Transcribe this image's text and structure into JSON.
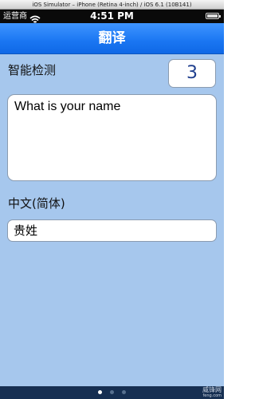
{
  "window": {
    "title": "iOS Simulator – iPhone (Retina 4-inch) / iOS 6.1 (10B141)"
  },
  "status_bar": {
    "carrier": "运营商",
    "time": "4:51 PM",
    "wifi_icon": "wifi-icon",
    "battery_icon": "battery-icon"
  },
  "nav": {
    "title": "翻译"
  },
  "detect": {
    "label": "智能检测",
    "count": "3"
  },
  "source": {
    "text": "What is your name"
  },
  "target": {
    "language": "中文(简体)",
    "result": "贵姓"
  },
  "page_control": {
    "pages": 3,
    "current": 1
  },
  "watermark": {
    "main": "威锋网",
    "sub": "feng.com"
  },
  "colors": {
    "nav_bar": "#1a76f2",
    "content_background": "#a6c7ed",
    "count_text": "#1f3f8e",
    "bottom_bar": "#162f52"
  }
}
